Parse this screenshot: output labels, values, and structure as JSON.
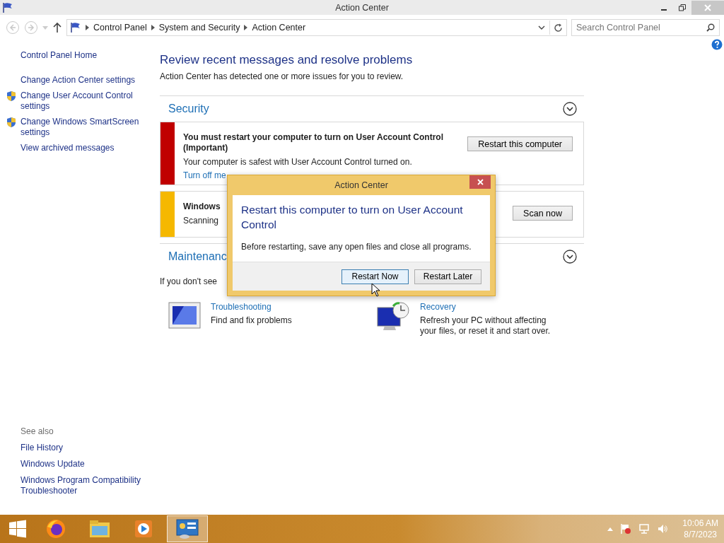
{
  "window": {
    "title": "Action Center"
  },
  "address": {
    "crumbs": [
      "Control Panel",
      "System and Security",
      "Action Center"
    ],
    "search_placeholder": "Search Control Panel"
  },
  "sidebar": {
    "items": [
      {
        "label": "Control Panel Home",
        "kind": "plain"
      },
      {
        "label": "Change Action Center settings",
        "kind": "plain"
      },
      {
        "label": "Change User Account Control settings",
        "kind": "shield"
      },
      {
        "label": "Change Windows SmartScreen settings",
        "kind": "shield"
      },
      {
        "label": "View archived messages",
        "kind": "plain"
      }
    ],
    "see_also_title": "See also",
    "see_also": [
      "File History",
      "Windows Update",
      "Windows Program Compatibility Troubleshooter"
    ]
  },
  "main": {
    "heading": "Review recent messages and resolve problems",
    "intro": "Action Center has detected one or more issues for you to review.",
    "sections": [
      {
        "title": "Security",
        "messages": [
          {
            "color": "#c00000",
            "title": "You must restart your computer to turn on User Account Control (Important)",
            "detail": "Your computer is safest with User Account Control turned on.",
            "link": "Turn off me",
            "button": "Restart this computer"
          },
          {
            "color": "#f5b800",
            "title": "Windows",
            "detail": "Scanning",
            "button": "Scan now"
          }
        ]
      },
      {
        "title": "Maintenanc"
      }
    ],
    "hint": "If you don't see",
    "tools": [
      {
        "kind": "troubleshoot",
        "title": "Troubleshooting",
        "desc": "Find and fix problems"
      },
      {
        "kind": "recovery",
        "title": "Recovery",
        "desc": "Refresh your PC without affecting your files, or reset it and start over."
      }
    ]
  },
  "dialog": {
    "title": "Action Center",
    "heading": "Restart this computer to turn on User Account Control",
    "body": "Before restarting, save any open files and close all programs.",
    "buttons": [
      {
        "label": "Restart Now",
        "selected": true
      },
      {
        "label": "Restart Later",
        "selected": false
      }
    ]
  },
  "taskbar": {
    "apps": [
      {
        "kind": "firefox",
        "selected": false
      },
      {
        "kind": "explorer",
        "selected": false
      },
      {
        "kind": "media",
        "selected": false
      },
      {
        "kind": "control",
        "selected": true
      }
    ],
    "time": "10:06 AM",
    "date": "8/7/2023"
  }
}
